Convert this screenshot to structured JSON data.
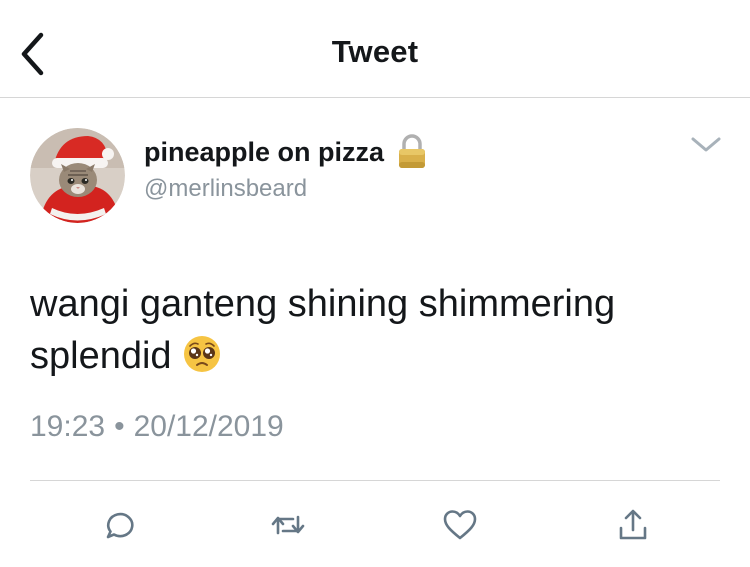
{
  "header": {
    "back_icon": "chevron-left-icon",
    "title": "Tweet"
  },
  "tweet": {
    "author": {
      "display_name": "pineapple on pizza",
      "handle": "@merlinsbeard",
      "protected_icon": "lock-icon",
      "avatar": "cat-in-santa-hat-avatar"
    },
    "caret_icon": "chevron-down-icon",
    "text": "wangi ganteng shining shimmering splendid",
    "emoji": "pleading-face-emoji",
    "time": "19:23",
    "separator": "•",
    "date": "20/12/2019"
  },
  "actions": [
    {
      "name": "reply",
      "icon": "comment-icon"
    },
    {
      "name": "retweet",
      "icon": "retweet-icon"
    },
    {
      "name": "like",
      "icon": "heart-icon"
    },
    {
      "name": "share",
      "icon": "share-icon"
    }
  ],
  "colors": {
    "text": "#14171a",
    "secondary": "#8a949c",
    "icon": "#657786",
    "divider": "#d6d6d6"
  }
}
